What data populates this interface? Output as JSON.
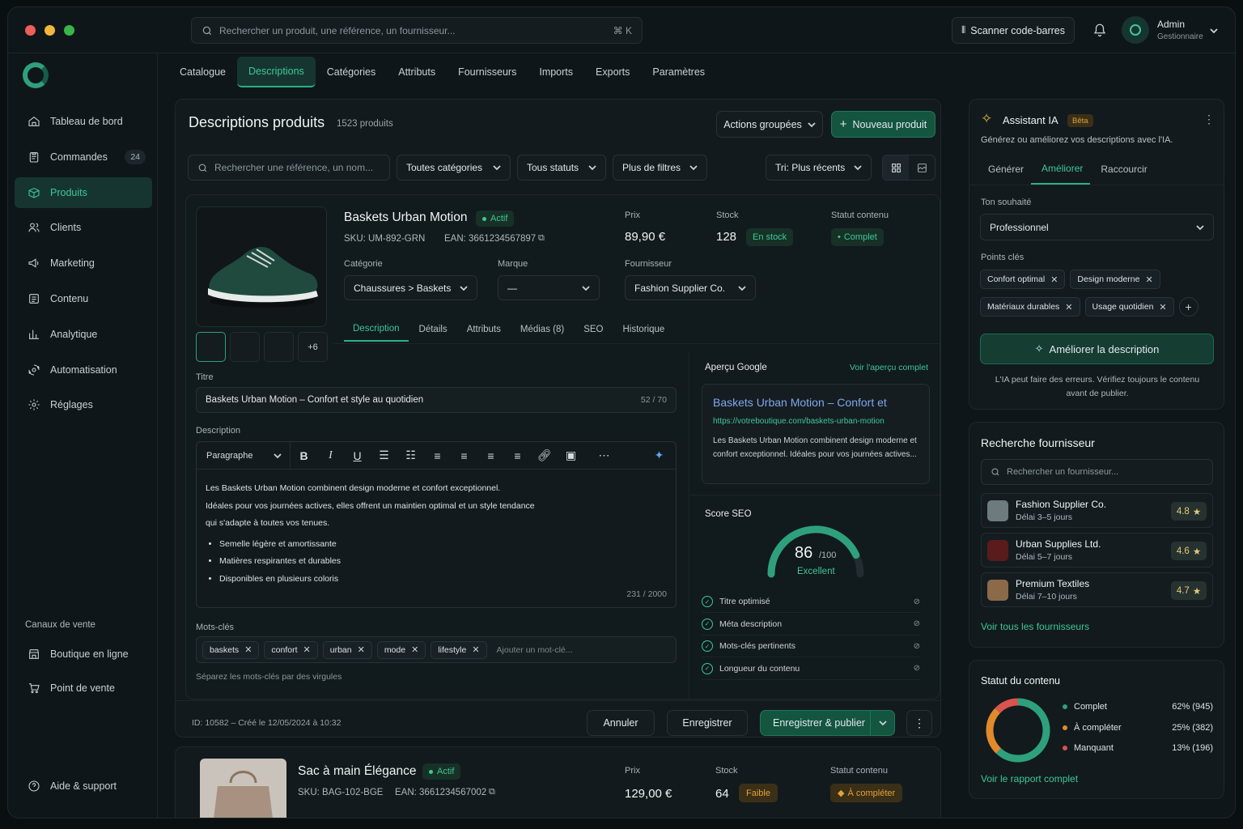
{
  "topbar": {
    "search_placeholder": "Rechercher un produit, une référence, un fournisseur...",
    "shortcut": "⌘ K",
    "scan_label": "Scanner code-barres",
    "user_name": "Admin",
    "user_role": "Gestionnaire"
  },
  "sidebar": {
    "items": [
      {
        "label": "Tableau de bord",
        "icon": "home-icon"
      },
      {
        "label": "Commandes",
        "icon": "clipboard-icon",
        "badge": "24"
      },
      {
        "label": "Produits",
        "icon": "box-icon",
        "active": true
      },
      {
        "label": "Clients",
        "icon": "users-icon"
      },
      {
        "label": "Marketing",
        "icon": "megaphone-icon"
      },
      {
        "label": "Contenu",
        "icon": "document-icon"
      },
      {
        "label": "Analytique",
        "icon": "bar-chart-icon"
      },
      {
        "label": "Automatisation",
        "icon": "automation-icon"
      },
      {
        "label": "Réglages",
        "icon": "gear-icon"
      }
    ],
    "channels_title": "Canaux de vente",
    "channels": [
      {
        "label": "Boutique en ligne"
      },
      {
        "label": "Point de vente"
      }
    ],
    "help": "Aide & support"
  },
  "top_tabs": [
    "Catalogue",
    "Descriptions",
    "Catégories",
    "Attributs",
    "Fournisseurs",
    "Imports",
    "Exports",
    "Paramètres"
  ],
  "page": {
    "title": "Descriptions produits",
    "count": "1523 produits",
    "bulk_actions": "Actions groupées",
    "new_product": "Nouveau produit",
    "search_placeholder": "Rechercher une référence, un nom...",
    "filter_categories": "Toutes catégories",
    "filter_status": "Tous statuts",
    "more_filters": "Plus de filtres",
    "sort": "Tri: Plus récents"
  },
  "product1": {
    "name": "Baskets Urban Motion",
    "status": "Actif",
    "sku": "SKU: UM-892-GRN",
    "ean": "EAN: 3661234567897",
    "price_label": "Prix",
    "price": "89,90 €",
    "stock_label": "Stock",
    "stock": "128",
    "stock_badge": "En stock",
    "content_label": "Statut contenu",
    "content_status": "Complet",
    "category_label": "Catégorie",
    "category": "Chaussures > Baskets",
    "brand_label": "Marque",
    "brand": "—",
    "supplier_label": "Fournisseur",
    "supplier": "Fashion Supplier Co.",
    "more_thumbs": "+6",
    "tabs": [
      "Description",
      "Détails",
      "Attributs",
      "Médias (8)",
      "SEO",
      "Historique"
    ],
    "title_label": "Titre",
    "title_value": "Baskets Urban Motion – Confort et style au quotidien",
    "title_count": "52 / 70",
    "desc_label": "Description",
    "paragraph": "Paragraphe",
    "desc_lines": [
      "Les Baskets Urban Motion combinent design moderne et confort exceptionnel.",
      "Idéales pour vos journées actives, elles offrent un maintien optimal et un style tendance",
      "qui s'adapte à toutes vos tenues."
    ],
    "bullets": [
      "Semelle légère et amortissante",
      "Matières respirantes et durables",
      "Disponibles en plusieurs coloris"
    ],
    "desc_count": "231 / 2000",
    "keywords_label": "Mots-clés",
    "keywords": [
      "baskets",
      "confort",
      "urban",
      "mode",
      "lifestyle"
    ],
    "keyword_placeholder": "Ajouter un mot-clé...",
    "keywords_hint": "Séparez les mots-clés par des virgules",
    "google_title": "Aperçu Google",
    "google_link": "Voir l'aperçu complet",
    "google_heading": "Baskets Urban Motion – Confort et",
    "google_url": "https://votreboutique.com/baskets-urban-motion",
    "google_desc": "Les Baskets Urban Motion combinent design moderne et confort exceptionnel. Idéales pour vos journées actives...",
    "seo_title": "Score SEO",
    "seo_score": 86,
    "seo_max": "/100",
    "seo_grade": "Excellent",
    "seo_checks": [
      "Titre optimisé",
      "Méta description",
      "Mots-clés pertinents",
      "Longueur du contenu"
    ],
    "footer_meta": "ID: 10582 – Créé le 12/05/2024 à 10:32",
    "cancel": "Annuler",
    "save": "Enregistrer",
    "save_publish": "Enregistrer & publier"
  },
  "product2": {
    "name": "Sac à main Élégance",
    "status": "Actif",
    "sku": "SKU: BAG-102-BGE",
    "ean": "EAN: 3661234567002",
    "price_label": "Prix",
    "price": "129,00 €",
    "stock_label": "Stock",
    "stock": "64",
    "stock_badge": "Faible",
    "content_label": "Statut contenu",
    "content_status": "À compléter"
  },
  "assistant": {
    "title": "Assistant IA",
    "beta": "Bêta",
    "subtitle": "Générez ou améliorez vos descriptions avec l'IA.",
    "tabs": [
      "Générer",
      "Améliorer",
      "Raccourcir"
    ],
    "tone_label": "Ton souhaité",
    "tone": "Professionnel",
    "points_label": "Points clés",
    "points": [
      "Confort optimal",
      "Design moderne",
      "Matériaux durables",
      "Usage quotidien"
    ],
    "action": "Améliorer la description",
    "disclaimer": "L'IA peut faire des erreurs. Vérifiez toujours le contenu avant de publier."
  },
  "suppliers": {
    "title": "Recherche fournisseur",
    "search_placeholder": "Rechercher un fournisseur...",
    "items": [
      {
        "name": "Fashion Supplier Co.",
        "delay": "Délai 3–5 jours",
        "rating": "4.8"
      },
      {
        "name": "Urban Supplies Ltd.",
        "delay": "Délai 5–7 jours",
        "rating": "4.6"
      },
      {
        "name": "Premium Textiles",
        "delay": "Délai 7–10 jours",
        "rating": "4.7"
      }
    ],
    "link": "Voir tous les fournisseurs"
  },
  "content_status": {
    "title": "Statut du contenu",
    "items": [
      {
        "label": "Complet",
        "value": "62% (945)",
        "pct": 62,
        "color": "#2fa07c"
      },
      {
        "label": "À compléter",
        "value": "25% (382)",
        "pct": 25,
        "color": "#e08a2c"
      },
      {
        "label": "Manquant",
        "value": "13% (196)",
        "pct": 13,
        "color": "#d9534f"
      }
    ],
    "link": "Voir le rapport complet"
  },
  "colors": {
    "accent": "#3ec79a",
    "accent_dark": "#163530",
    "warning": "#e3a23a"
  }
}
